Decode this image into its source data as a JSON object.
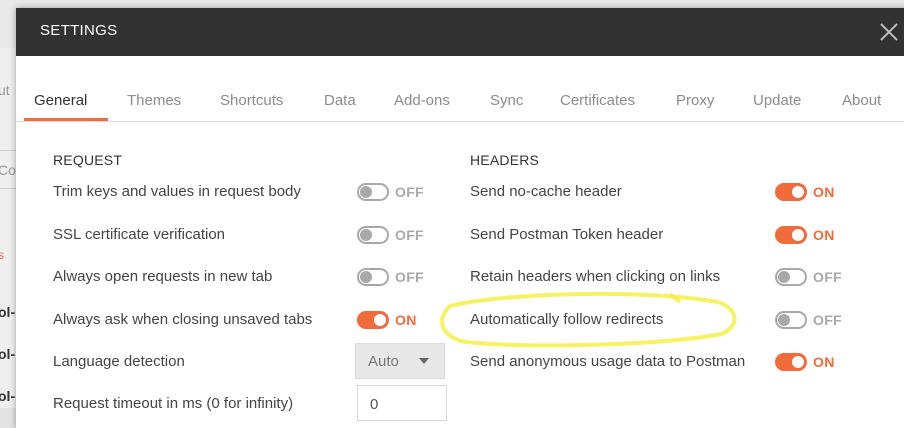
{
  "background": {
    "fragments": [
      "ut",
      "Co",
      "s",
      "ol-",
      "ol-",
      "ol-"
    ]
  },
  "modal": {
    "title": "SETTINGS",
    "close_icon": "close-icon"
  },
  "tabs": [
    {
      "label": "General",
      "active": true
    },
    {
      "label": "Themes",
      "active": false
    },
    {
      "label": "Shortcuts",
      "active": false
    },
    {
      "label": "Data",
      "active": false
    },
    {
      "label": "Add-ons",
      "active": false
    },
    {
      "label": "Sync",
      "active": false
    },
    {
      "label": "Certificates",
      "active": false
    },
    {
      "label": "Proxy",
      "active": false
    },
    {
      "label": "Update",
      "active": false
    },
    {
      "label": "About",
      "active": false
    }
  ],
  "request": {
    "title": "REQUEST",
    "rows": [
      {
        "label": "Trim keys and values in request body",
        "state": "OFF"
      },
      {
        "label": "SSL certificate verification",
        "state": "OFF"
      },
      {
        "label": "Always open requests in new tab",
        "state": "OFF"
      },
      {
        "label": "Always ask when closing unsaved tabs",
        "state": "ON"
      }
    ],
    "language_detection": {
      "label": "Language detection",
      "value": "Auto"
    },
    "timeout": {
      "label": "Request timeout in ms (0 for infinity)",
      "value": "0"
    }
  },
  "headers": {
    "title": "HEADERS",
    "rows": [
      {
        "label": "Send no-cache header",
        "state": "ON"
      },
      {
        "label": "Send Postman Token header",
        "state": "ON"
      },
      {
        "label": "Retain headers when clicking on links",
        "state": "OFF"
      },
      {
        "label": "Automatically follow redirects",
        "state": "OFF"
      },
      {
        "label": "Send anonymous usage data to Postman",
        "state": "ON"
      }
    ]
  },
  "colors": {
    "accent": "#f26b3a",
    "header_bg": "#323232",
    "toggle_off": "#a9a9a9",
    "highlight": "#f5f046"
  }
}
